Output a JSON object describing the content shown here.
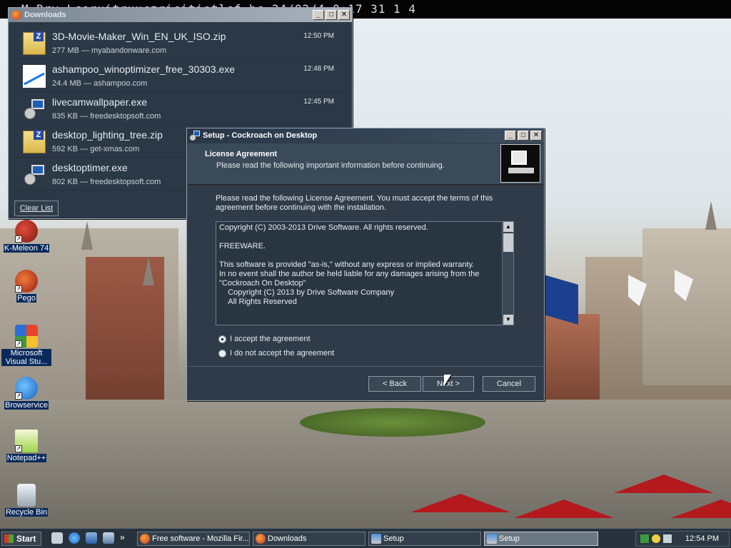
{
  "topbar": {
    "text": "M  Drv  Lcoruitruuczricitiotlcf hc 24/02/4 0:17 31 1 4"
  },
  "desktop_icons": [
    {
      "label": "K-Meleon 74"
    },
    {
      "label": "Pego"
    },
    {
      "label": "Microsoft Visual Stu..."
    },
    {
      "label": "Browservice"
    },
    {
      "label": "Notepad++"
    },
    {
      "label": "Recycle Bin"
    }
  ],
  "downloads": {
    "title": "Downloads",
    "items": [
      {
        "name": "3D-Movie-Maker_Win_EN_UK_ISO.zip",
        "meta": "277 MB — myabandonware.com",
        "time": "12:50 PM",
        "icon": "zip-file-icon"
      },
      {
        "name": "ashampoo_winoptimizer_free_30303.exe",
        "meta": "24.4 MB — ashampoo.com",
        "time": "12:48 PM",
        "icon": "exe-file-icon"
      },
      {
        "name": "livecamwallpaper.exe",
        "meta": "835 KB — freedesktopsoft.com",
        "time": "12:45 PM",
        "icon": "setup-file-icon"
      },
      {
        "name": "desktop_lighting_tree.zip",
        "meta": "592 KB — get-xmas.com",
        "time": "",
        "icon": "zip-file-icon"
      },
      {
        "name": "desktoptimer.exe",
        "meta": "802 KB — freedesktopsoft.com",
        "time": "",
        "icon": "setup-file-icon"
      }
    ],
    "clear_label": "Clear List"
  },
  "setup": {
    "title": "Setup - Cockroach on Desktop",
    "heading": "License Agreement",
    "subheading": "Please read the following important information before continuing.",
    "intro": "Please read the following License Agreement. You must accept the terms of this agreement before continuing with the installation.",
    "license_text": "Copyright (C) 2003-2013 Drive Software. All rights reserved.\n\nFREEWARE.\n\nThis software is provided \"as-is,\" without any express or implied warranty.\nIn no event shall the author be held liable for any damages arising from the\n\"Cockroach On Desktop\"\n    Copyright (C) 2013 by Drive Software Company\n    All Rights Reserved",
    "accept_label": "I accept the agreement",
    "decline_label": "I do not accept the agreement",
    "accepted": true,
    "back_label": "< Back",
    "next_label": "Next >",
    "cancel_label": "Cancel"
  },
  "taskbar": {
    "start_label": "Start",
    "tasks": [
      {
        "label": "Free software - Mozilla Fir..."
      },
      {
        "label": "Downloads"
      },
      {
        "label": "Setup"
      },
      {
        "label": "Setup"
      }
    ],
    "clock": "12:54 PM"
  }
}
